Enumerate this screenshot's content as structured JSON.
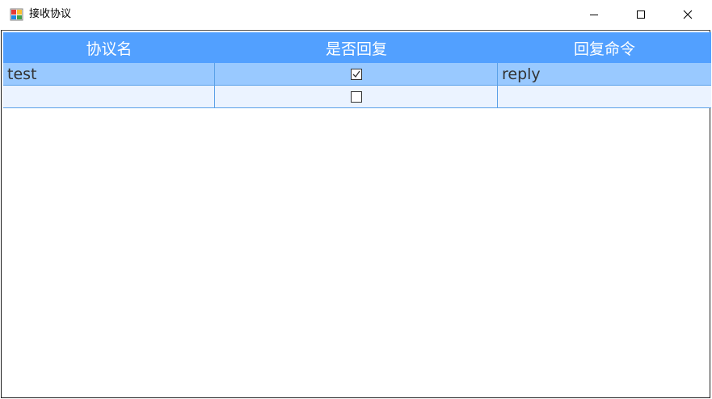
{
  "window": {
    "title": "接收协议",
    "icon": "app-window-icon"
  },
  "grid": {
    "columns": [
      "协议名",
      "是否回复",
      "回复命令"
    ],
    "rows": [
      {
        "name": "test",
        "reply": true,
        "command": "reply"
      },
      {
        "name": "",
        "reply": false,
        "command": ""
      }
    ],
    "colors": {
      "header_bg": "#52a0ff",
      "selected_row_bg": "#99c9ff",
      "new_row_bg": "#ebf3ff",
      "grid_line": "#5aa0e8"
    }
  }
}
